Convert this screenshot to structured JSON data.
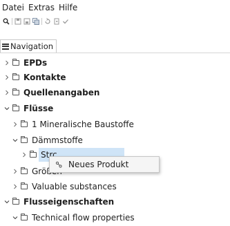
{
  "menu": {
    "file": "Datei",
    "extras": "Extras",
    "help": "Hilfe"
  },
  "toolbar": {
    "icons": [
      "search-icon",
      "save-icon",
      "save-as-icon",
      "save-all-icon",
      "undo-icon",
      "redo-icon",
      "check-icon"
    ]
  },
  "tab": {
    "label": "Navigation"
  },
  "tree": {
    "epds": "EPDs",
    "kontakte": "Kontakte",
    "quellen": "Quellenangaben",
    "fluesse": "Flüsse",
    "mineral": "1 Mineralische Baustoffe",
    "daemm": "Dämmstoffe",
    "stro": "Strc",
    "groessen": "Größen",
    "valuable": "Valuable substances",
    "flusseig": "Flusseigenschaften",
    "technical": "Technical flow properties"
  },
  "context_menu": {
    "new_product": "Neues Produkt"
  }
}
